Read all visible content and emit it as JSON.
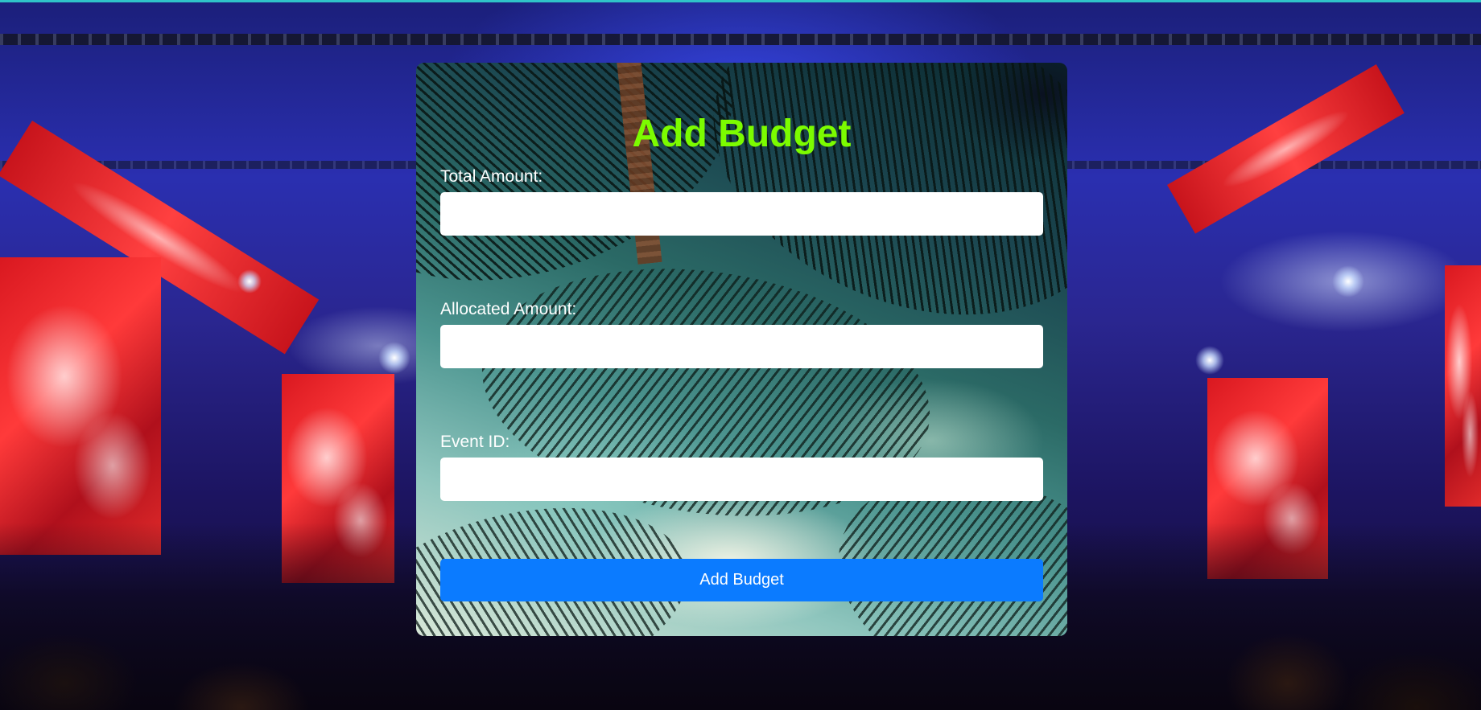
{
  "form": {
    "title": "Add Budget",
    "fields": [
      {
        "label": "Total Amount:",
        "value": "",
        "placeholder": ""
      },
      {
        "label": "Allocated Amount:",
        "value": "",
        "placeholder": ""
      },
      {
        "label": "Event ID:",
        "value": "",
        "placeholder": ""
      }
    ],
    "submit_label": "Add Budget"
  },
  "colors": {
    "title": "#7cfc00",
    "button": "#0b7bff",
    "label": "#ffffff",
    "top_strip": "#2fc4c8"
  }
}
